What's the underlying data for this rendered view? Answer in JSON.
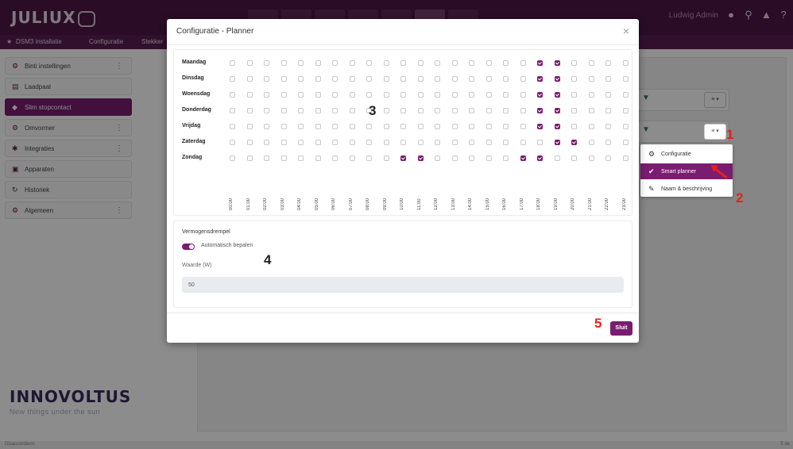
{
  "app": {
    "logo": "JULIUX",
    "user": "Ludwig Admin"
  },
  "breadcrumb": [
    "DSM3 installatie",
    "Configuratie",
    "Stekker"
  ],
  "sidebar": {
    "items": [
      {
        "label": "Binti instellingen",
        "icon": "gear-icon",
        "dots": "⋮"
      },
      {
        "label": "Laadpaal",
        "icon": "charger-icon"
      },
      {
        "label": "Slim stopcontact",
        "icon": "plug-icon",
        "active": true
      },
      {
        "label": "Omvormer",
        "icon": "gear-icon",
        "dots": "⋮"
      },
      {
        "label": "Integraties",
        "icon": "puzzle-icon",
        "dots": "⋮"
      },
      {
        "label": "Apparaten",
        "icon": "device-icon"
      },
      {
        "label": "Historiek",
        "icon": "history-icon"
      },
      {
        "label": "Algemeen",
        "icon": "gear-icon",
        "dots": "⋮"
      }
    ]
  },
  "brand": {
    "name": "INNOVOLTUS",
    "tagline": "New things under the sun"
  },
  "footer": {
    "left": "Disaccordions",
    "right": "5 de"
  },
  "background": {
    "menu_button": "≡ ▾"
  },
  "dropdown": {
    "items": [
      {
        "label": "Configuratie",
        "icon": "gear-icon"
      },
      {
        "label": "Smart planner",
        "icon": "planner-icon",
        "selected": true
      },
      {
        "label": "Naam & beschrijving",
        "icon": "label-icon"
      }
    ]
  },
  "modal": {
    "title": "Configuratie - Planner",
    "close_icon": "×",
    "schedule": {
      "days": [
        {
          "name": "Maandag",
          "on": [
            18,
            19
          ]
        },
        {
          "name": "Dinsdag",
          "on": [
            18,
            19
          ]
        },
        {
          "name": "Woensdag",
          "on": [
            18,
            19
          ]
        },
        {
          "name": "Donderdag",
          "on": [
            18,
            19
          ]
        },
        {
          "name": "Vrijdag",
          "on": [
            18,
            19
          ]
        },
        {
          "name": "Zaterdag",
          "on": [
            19,
            20
          ]
        },
        {
          "name": "Zondag",
          "on": [
            10,
            11,
            17,
            18
          ]
        }
      ],
      "hours": [
        "00:00",
        "01:00",
        "02:00",
        "03:00",
        "04:00",
        "05:00",
        "06:00",
        "07:00",
        "08:00",
        "09:00",
        "10:00",
        "11:00",
        "12:00",
        "13:00",
        "14:00",
        "15:00",
        "16:00",
        "17:00",
        "18:00",
        "19:00",
        "20:00",
        "21:00",
        "22:00",
        "23:00"
      ]
    },
    "power": {
      "title": "Vermogensdrempel",
      "toggle_label": "Automatisch bepalen",
      "toggle_on": true,
      "field_label": "Waarde (W)",
      "field_value": "50"
    },
    "close_button": "Sluit"
  },
  "annotations": {
    "a1": "1",
    "a2": "2",
    "a3": "3",
    "a4": "4",
    "a5": "5"
  },
  "colors": {
    "brand_dark": "#4d1646",
    "accent": "#7a1c70",
    "annotation_red": "#e8201b"
  }
}
